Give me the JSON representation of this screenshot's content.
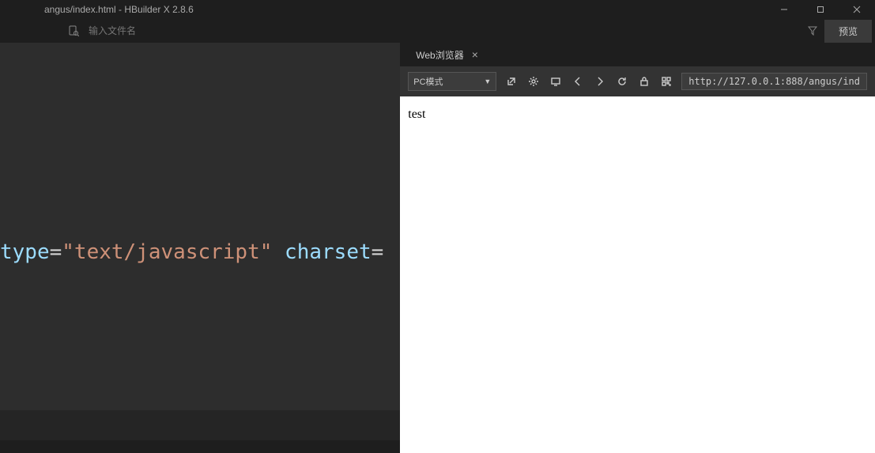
{
  "window": {
    "title": "angus/index.html - HBuilder X 2.8.6"
  },
  "toolbar": {
    "search_placeholder": "输入文件名",
    "preview_label": "预览"
  },
  "editor": {
    "code": {
      "attr1": "type",
      "val1": "\"text/javascript\"",
      "attr2": "charset"
    }
  },
  "browser": {
    "tab_label": "Web浏览器",
    "mode_label": "PC模式",
    "url": "http://127.0.0.1:888/angus/ind",
    "page_text": "test"
  }
}
